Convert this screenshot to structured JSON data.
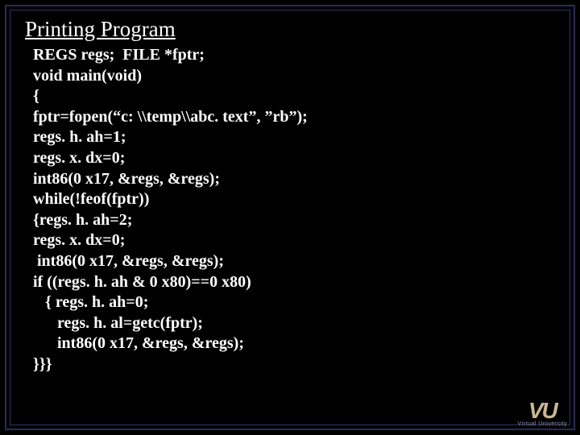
{
  "title": "Printing Program",
  "code": [
    "REGS regs;  FILE *fptr;",
    "void main(void)",
    "{",
    "fptr=fopen(“c: \\\\temp\\\\abc. text”, ”rb”);",
    "regs. h. ah=1;",
    "regs. x. dx=0;",
    "int86(0 x17, &regs, &regs);",
    "while(!feof(fptr))",
    "{regs. h. ah=2;",
    "regs. x. dx=0;",
    " int86(0 x17, &regs, &regs);",
    "if ((regs. h. ah & 0 x80)==0 x80)",
    "   { regs. h. ah=0;",
    "      regs. h. al=getc(fptr);",
    "      int86(0 x17, &regs, &regs);",
    "}}}"
  ],
  "logo": {
    "main": "VU",
    "sub": "Virtual University"
  }
}
